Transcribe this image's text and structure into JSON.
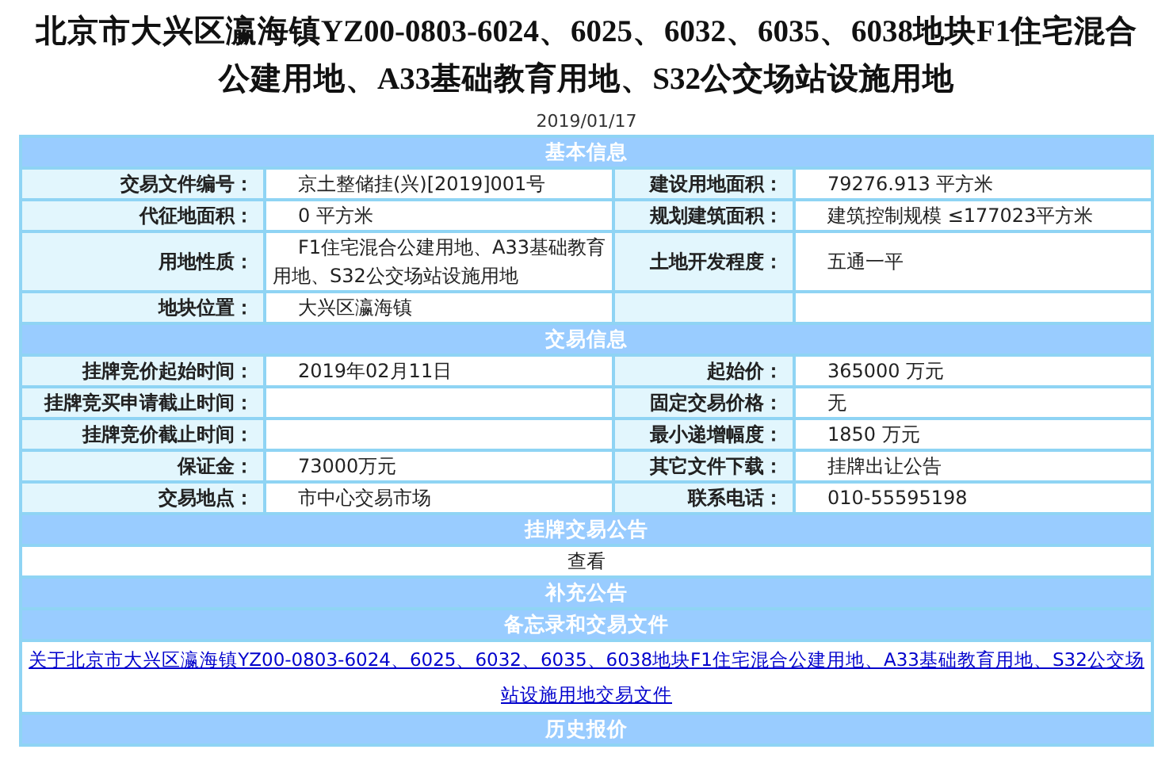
{
  "title": "北京市大兴区瀛海镇YZ00-0803-6024、6025、6032、6035、6038地块F1住宅混合公建用地、A33基础教育用地、S32公交场站设施用地",
  "date": "2019/01/17",
  "sections": [
    {
      "kind": "fields",
      "heading": "基本信息",
      "rows": [
        {
          "label": "交易文件编号：",
          "value": "京土整储挂(兴)[2019]001号",
          "label2": "建设用地面积：",
          "value2": "79276.913 平方米"
        },
        {
          "label": "代征地面积：",
          "value": "0 平方米",
          "label2": "规划建筑面积：",
          "value2": "建筑控制规模 ≤177023平方米"
        },
        {
          "label": "用地性质：",
          "value": "F1住宅混合公建用地、A33基础教育用地、S32公交场站设施用地",
          "label2": "土地开发程度：",
          "value2": "五通一平"
        },
        {
          "label": "地块位置：",
          "value": "大兴区瀛海镇"
        }
      ]
    },
    {
      "kind": "fields",
      "heading": "交易信息",
      "rows": [
        {
          "label": "挂牌竞价起始时间：",
          "value": "2019年02月11日",
          "label2": "起始价：",
          "value2": "365000 万元"
        },
        {
          "label": "挂牌竞买申请截止时间：",
          "label2": "固定交易价格：",
          "value2": "无"
        },
        {
          "label": "挂牌竞价截止时间：",
          "label2": "最小递增幅度：",
          "value2": "1850 万元"
        },
        {
          "label": "保证金：",
          "value": "73000万元",
          "label2": "其它文件下载：",
          "value2": "挂牌出让公告"
        },
        {
          "label": "交易地点：",
          "value": "市中心交易市场",
          "label2": "联系电话：",
          "value2": "010-55595198"
        }
      ]
    },
    {
      "kind": "text",
      "heading": "挂牌交易公告",
      "content": "查看"
    },
    {
      "kind": "empty",
      "heading": "补充公告"
    },
    {
      "kind": "link",
      "heading": "备忘录和交易文件",
      "content": "关于北京市大兴区瀛海镇YZ00-0803-6024、6025、6032、6035、6038地块F1住宅混合公建用地、A33基础教育用地、S32公交场站设施用地交易文件"
    },
    {
      "kind": "empty",
      "heading": "历史报价"
    }
  ]
}
